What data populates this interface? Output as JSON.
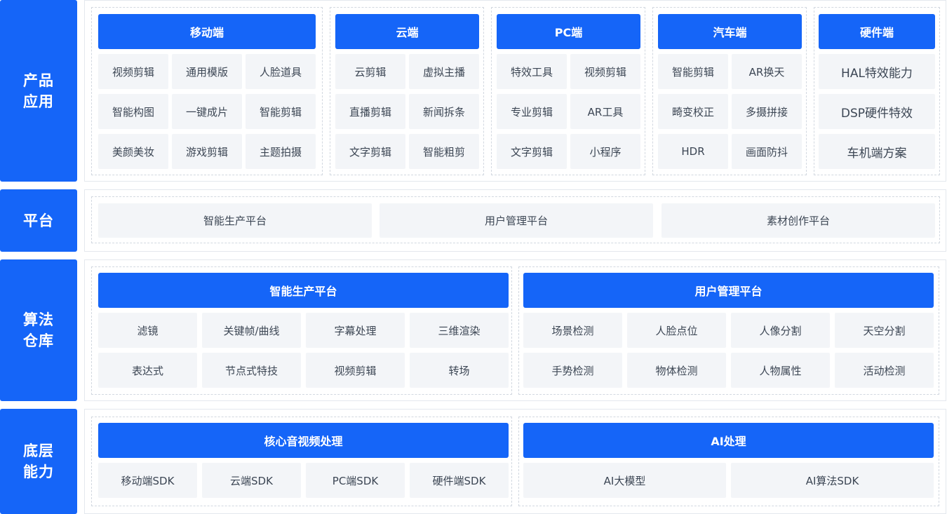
{
  "layers": {
    "product": "产品应用",
    "platform": "平台",
    "algorithm": "算法仓库",
    "base": "底层能力"
  },
  "product": {
    "groups": [
      {
        "title": "移动端",
        "items": [
          "视频剪辑",
          "通用模版",
          "人脸道具",
          "智能构图",
          "一键成片",
          "智能剪辑",
          "美颜美妆",
          "游戏剪辑",
          "主题拍摄"
        ]
      },
      {
        "title": "云端",
        "items": [
          "云剪辑",
          "虚拟主播",
          "直播剪辑",
          "新闻拆条",
          "文字剪辑",
          "智能粗剪"
        ]
      },
      {
        "title": "PC端",
        "items": [
          "特效工具",
          "视频剪辑",
          "专业剪辑",
          "AR工具",
          "文字剪辑",
          "小程序"
        ]
      },
      {
        "title": "汽车端",
        "items": [
          "智能剪辑",
          "AR换天",
          "畸变校正",
          "多摄拼接",
          "HDR",
          "画面防抖"
        ]
      },
      {
        "title": "硬件端",
        "items": [
          "HAL特效能力",
          "DSP硬件特效",
          "车机端方案"
        ]
      }
    ]
  },
  "platform": {
    "items": [
      "智能生产平台",
      "用户管理平台",
      "素材创作平台"
    ]
  },
  "algorithm": {
    "groups": [
      {
        "title": "智能生产平台",
        "items": [
          "滤镜",
          "关键帧/曲线",
          "字幕处理",
          "三维渲染",
          "表达式",
          "节点式特技",
          "视频剪辑",
          "转场"
        ]
      },
      {
        "title": "用户管理平台",
        "items": [
          "场景检测",
          "人脸点位",
          "人像分割",
          "天空分割",
          "手势检测",
          "物体检测",
          "人物属性",
          "活动检测"
        ]
      }
    ]
  },
  "base": {
    "groups": [
      {
        "title": "核心音视频处理",
        "items": [
          "移动端SDK",
          "云端SDK",
          "PC端SDK",
          "硬件端SDK"
        ]
      },
      {
        "title": "AI处理",
        "items": [
          "AI大模型",
          "AI算法SDK"
        ]
      }
    ]
  },
  "colors": {
    "accent": "#1565f8",
    "cell": "#f3f5f8",
    "text": "#3c4654"
  }
}
